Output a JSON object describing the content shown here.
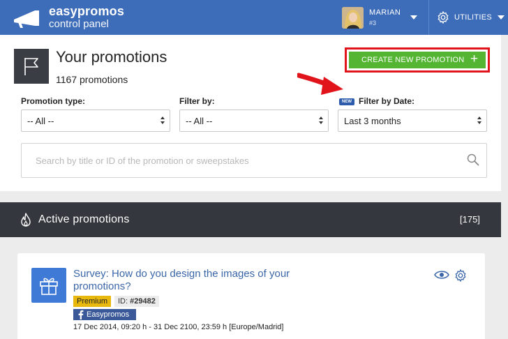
{
  "header": {
    "brand_name": "easypromos",
    "brand_sub": "control panel",
    "user_name": "MARIAN",
    "user_number": "#3",
    "utilities_label": "UTILITIES",
    "bg_color": "#3d6cb9"
  },
  "main": {
    "title": "Your promotions",
    "count": "1167 promotions",
    "create_button_label": "CREATE NEW PROMOTION",
    "create_button_plus": "+",
    "filters": {
      "promotion_type_label": "Promotion type:",
      "promotion_type_value": "-- All --",
      "filter_by_label": "Filter by:",
      "filter_by_value": "-- All --",
      "new_badge": "NEW",
      "filter_date_label": "Filter by Date:",
      "filter_date_value": "Last 3 months"
    },
    "search": {
      "placeholder": "Search by title or ID of the promotion or sweepstakes"
    }
  },
  "active": {
    "label": "Active promotions",
    "count": "[175]"
  },
  "promotions": [
    {
      "title": "Survey: How do you design the images of your promotions?",
      "plan": "Premium",
      "id_label": "ID:",
      "id_value": "#29482",
      "page_name": "Easypromos",
      "dates": "17 Dec 2014, 09:20 h - 31 Dec 2100, 23:59 h [Europe/Madrid]"
    }
  ],
  "icons": {
    "logo": "megaphone-icon",
    "utilities": "gear-icon",
    "page": "flag-icon",
    "search": "search-icon",
    "active": "fire-icon",
    "promo": "gift-icon",
    "view": "eye-icon",
    "settings": "gear-icon",
    "facebook": "facebook-icon"
  },
  "colors": {
    "accent_green": "#53b532",
    "highlight_red": "#e1141b",
    "premium_yellow": "#e8b80c",
    "facebook_blue": "#3b5998",
    "dark_bar": "#34373d"
  }
}
